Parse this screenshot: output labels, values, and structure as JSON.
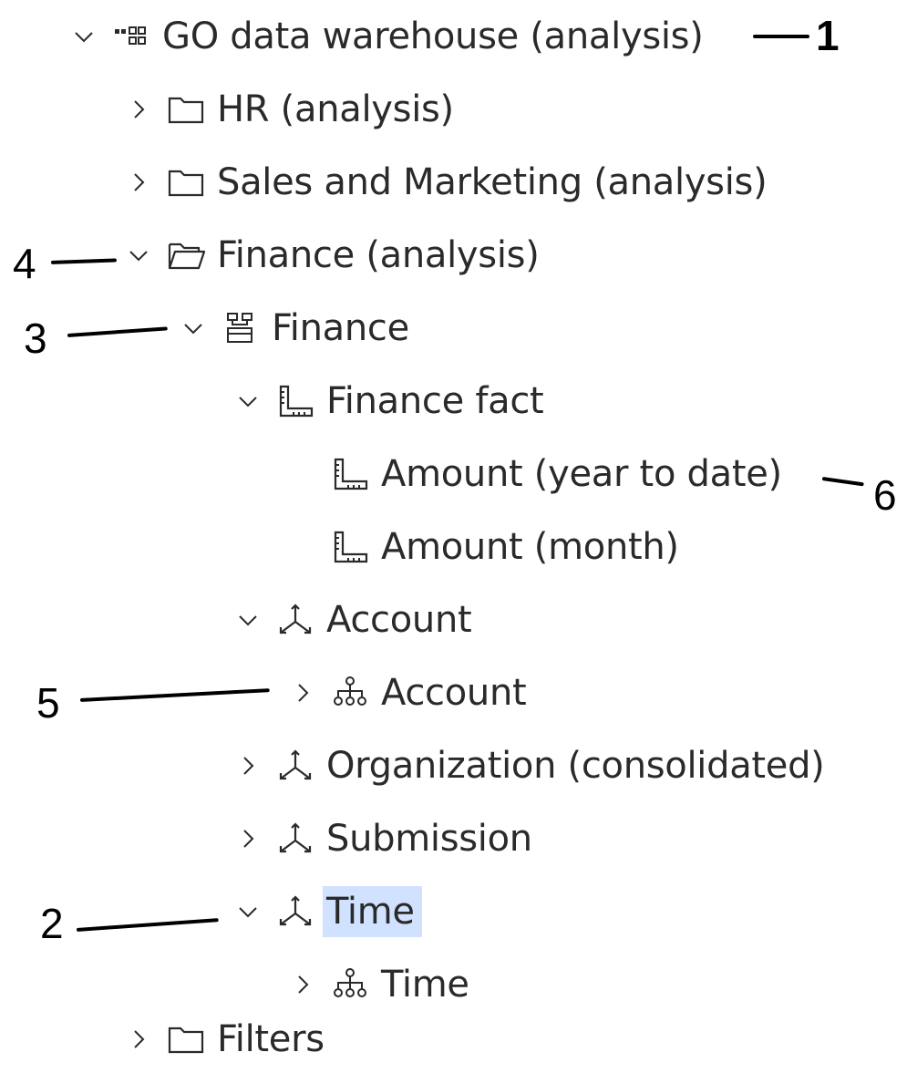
{
  "tree": {
    "items": [
      {
        "label": "GO data warehouse (analysis)",
        "icon": "data-module-icon",
        "expanded": true
      },
      {
        "label": "HR (analysis)",
        "icon": "folder-icon",
        "expanded": false
      },
      {
        "label": "Sales and Marketing (analysis)",
        "icon": "folder-icon",
        "expanded": false
      },
      {
        "label": "Finance (analysis)",
        "icon": "folder-open-icon",
        "expanded": true
      },
      {
        "label": "Finance",
        "icon": "package-icon",
        "expanded": true
      },
      {
        "label": "Finance fact",
        "icon": "measure-icon",
        "expanded": true
      },
      {
        "label": "Amount (year to date)",
        "icon": "measure-icon"
      },
      {
        "label": "Amount (month)",
        "icon": "measure-icon"
      },
      {
        "label": "Account",
        "icon": "dimension-icon",
        "expanded": true
      },
      {
        "label": "Account",
        "icon": "hierarchy-icon",
        "expanded": false
      },
      {
        "label": "Organization (consolidated)",
        "icon": "dimension-icon",
        "expanded": false
      },
      {
        "label": "Submission",
        "icon": "dimension-icon",
        "expanded": false
      },
      {
        "label": "Time",
        "icon": "dimension-icon",
        "expanded": true,
        "selected": true
      },
      {
        "label": "Time",
        "icon": "hierarchy-icon",
        "expanded": false
      },
      {
        "label": "Filters",
        "icon": "folder-icon",
        "expanded": false
      }
    ],
    "selected_highlight_color": "#d0e2ff"
  },
  "callouts": [
    "1",
    "2",
    "3",
    "4",
    "5",
    "6"
  ]
}
